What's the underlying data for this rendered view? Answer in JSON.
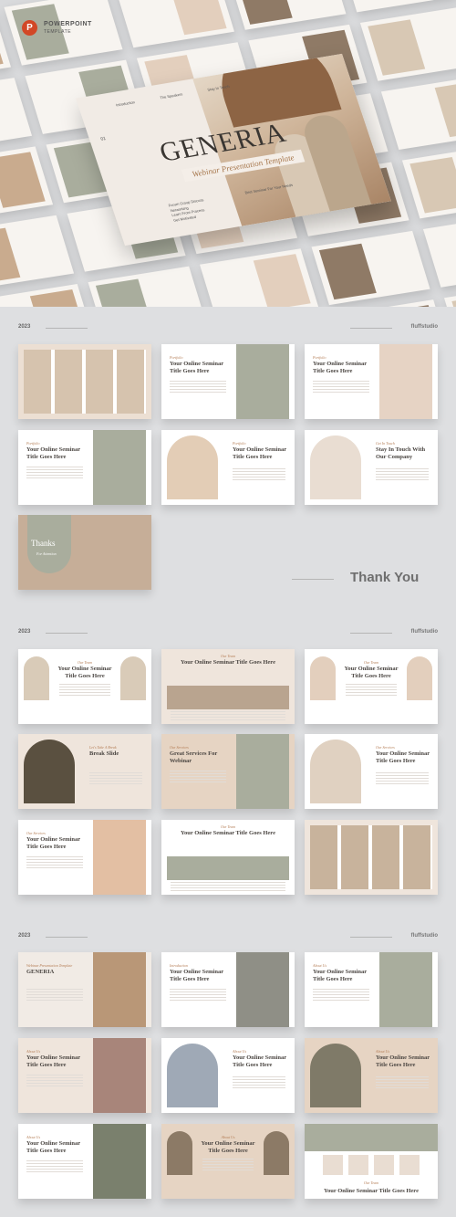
{
  "brand": {
    "logo_letter": "P",
    "line1": "POWERPOINT",
    "line2": "TEMPLATE"
  },
  "hero": {
    "title": "GENERIA",
    "subtitle": "Webinar Presentation Template",
    "nav": [
      "Introduction",
      "The Speakers",
      "Stay In Touch"
    ],
    "number": "01",
    "bullets": [
      "Forum Group Discuss",
      "Networking",
      "Learn From Process",
      "Get Motivated"
    ],
    "tagline": "Best Seminar For Your Needs"
  },
  "colors": {
    "background": "#dedfe1",
    "beige": "#ecdfd3",
    "tan": "#c9ab8e",
    "sage": "#a9ad9d",
    "accent": "#b47d55",
    "text": "#4a4541"
  },
  "sections": [
    {
      "year": "2023",
      "brand": "fluffstudio",
      "slides": [
        {
          "label": "",
          "title": "",
          "layout": "grid",
          "bg": "#ecdfd3",
          "photo": "#d6c3ae"
        },
        {
          "label": "Portfolio",
          "title": "Your Online Seminar Title Goes Here",
          "layout": "text-left",
          "bg": "#ffffff",
          "photo": "#a9ad9d"
        },
        {
          "label": "Portfolio",
          "title": "Your Online Seminar Title Goes Here",
          "layout": "text-left",
          "bg": "#ffffff",
          "photo": "#e6d3c4"
        },
        {
          "label": "Portfolio",
          "title": "Your Online Seminar Title Goes Here",
          "layout": "text-left",
          "bg": "#ffffff",
          "photo": "#a9ad9d"
        },
        {
          "label": "Portfolio",
          "title": "Your Online Seminar Title Goes Here",
          "layout": "text-right",
          "bg": "#ffffff",
          "photo": "#e3cdb6"
        },
        {
          "label": "Get In Touch",
          "title": "Stay In Touch With Our Company",
          "layout": "text-right",
          "bg": "#ffffff",
          "photo": "#e9ddd2"
        },
        {
          "label": "For Attention",
          "title": "Thanks",
          "layout": "thanks",
          "bg": "#c6ae98",
          "photo": "#a9ad9d"
        }
      ]
    },
    {
      "year": "2023",
      "brand": "fluffstudio",
      "slides": [
        {
          "label": "Our Team",
          "title": "Your Online Seminar Title Goes Here",
          "layout": "text-center",
          "bg": "#ffffff",
          "photo": "#d9cbb8"
        },
        {
          "label": "Our Team",
          "title": "Your Online Seminar Title Goes Here",
          "layout": "text-top",
          "bg": "#efe5dc",
          "photo": "#b9a48f"
        },
        {
          "label": "Our Team",
          "title": "Your Online Seminar Title Goes Here",
          "layout": "text-center",
          "bg": "#ffffff",
          "photo": "#e3cfbd"
        },
        {
          "label": "Let's Take A Break",
          "title": "Break Slide",
          "layout": "text-right",
          "bg": "#efe5dc",
          "photo": "#5a5040"
        },
        {
          "label": "Our Services",
          "title": "Great Services For Webinar",
          "layout": "text-left",
          "bg": "#e6d4c3",
          "photo": "#a9ad9d"
        },
        {
          "label": "Our Services",
          "title": "Your Online Seminar Title Goes Here",
          "layout": "text-right",
          "bg": "#ffffff",
          "photo": "#e0d1c1"
        },
        {
          "label": "Our Services",
          "title": "Your Online Seminar Title Goes Here",
          "layout": "text-left",
          "bg": "#ffffff",
          "photo": "#e3bfa3"
        },
        {
          "label": "Our Team",
          "title": "Your Online Seminar Title Goes Here",
          "layout": "text-top",
          "bg": "#ffffff",
          "photo": "#a9ad9d"
        },
        {
          "label": "",
          "title": "",
          "layout": "grid",
          "bg": "#efe5dc",
          "photo": "#c8b39c"
        }
      ]
    },
    {
      "year": "2023",
      "brand": "fluffstudio",
      "slides": [
        {
          "label": "Webinar Presentation Template",
          "title": "GENERIA",
          "layout": "text-left",
          "bg": "#f1ebe5",
          "photo": "#b99777"
        },
        {
          "label": "Introduction",
          "title": "Your Online Seminar Title Goes Here",
          "layout": "text-left",
          "bg": "#ffffff",
          "photo": "#8f8f86"
        },
        {
          "label": "About Us",
          "title": "Your Online Seminar Title Goes Here",
          "layout": "text-left",
          "bg": "#ffffff",
          "photo": "#a9ad9d"
        },
        {
          "label": "About Us",
          "title": "Your Online Seminar Title Goes Here",
          "layout": "text-left",
          "bg": "#efe5dc",
          "photo": "#a8857a"
        },
        {
          "label": "About Us",
          "title": "Your Online Seminar Title Goes Here",
          "layout": "text-right",
          "bg": "#ffffff",
          "photo": "#9fa9b6"
        },
        {
          "label": "About Us",
          "title": "Your Online Seminar Title Goes Here",
          "layout": "text-right",
          "bg": "#e6d4c3",
          "photo": "#7f7a68"
        },
        {
          "label": "About Us",
          "title": "Your Online Seminar Title Goes Here",
          "layout": "text-left",
          "bg": "#ffffff",
          "photo": "#7a806d"
        },
        {
          "label": "About Us",
          "title": "Your Online Seminar Title Goes Here",
          "layout": "text-center",
          "bg": "#e6d4c3",
          "photo": "#8c7a66"
        },
        {
          "label": "Our Team",
          "title": "Your Online Seminar Title Goes Here",
          "layout": "text-bottom",
          "bg": "#ffffff",
          "photo": "#a9ad9d"
        }
      ]
    }
  ],
  "thank_you": "Thank You"
}
